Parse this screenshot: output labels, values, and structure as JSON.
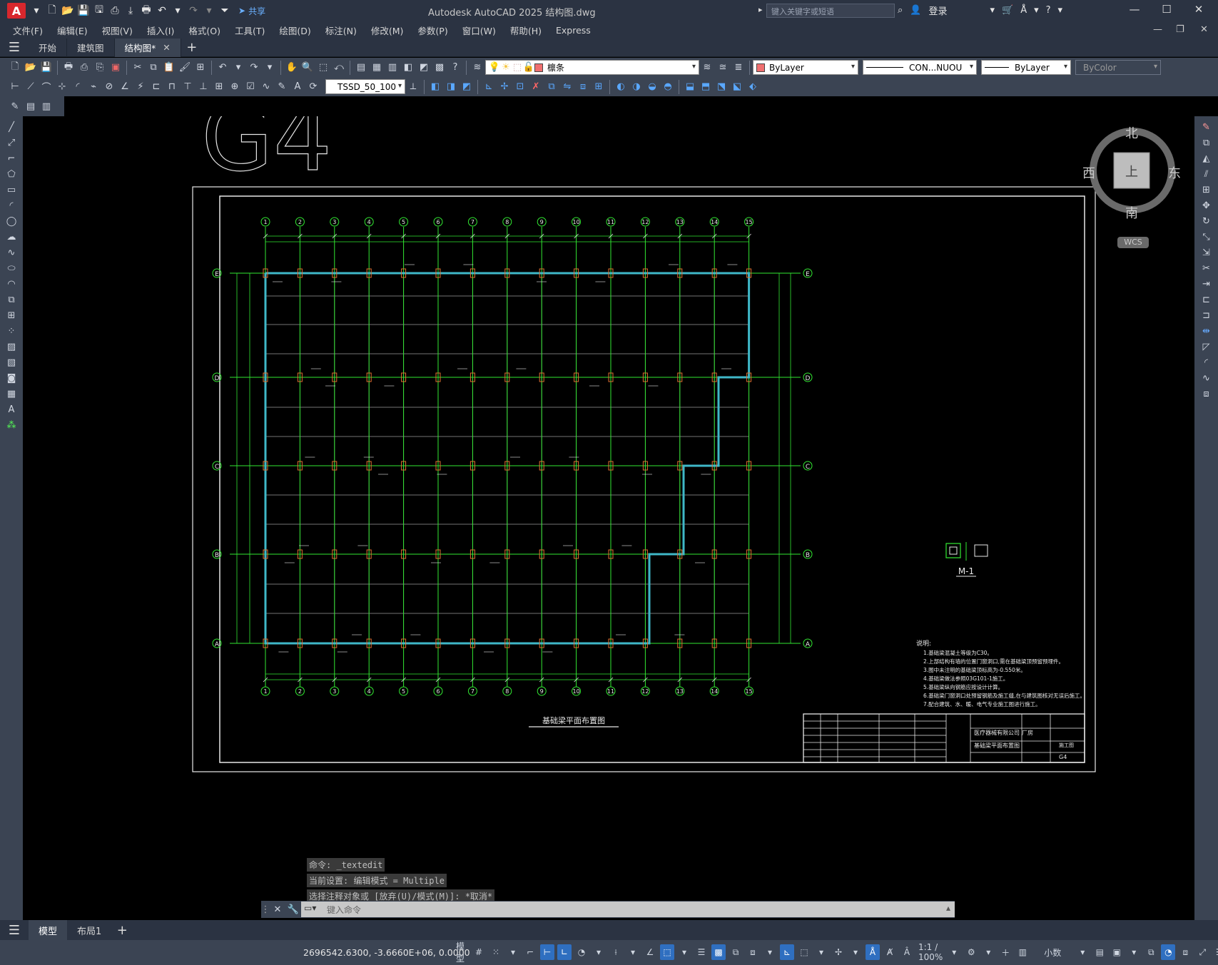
{
  "titlebar": {
    "app_logo": "A",
    "share_label": "共享",
    "title": "Autodesk AutoCAD 2025    结构图.dwg",
    "search_placeholder": "键入关键字或短语",
    "signin_label": "登录"
  },
  "menu": [
    "文件(F)",
    "编辑(E)",
    "视图(V)",
    "插入(I)",
    "格式(O)",
    "工具(T)",
    "绘图(D)",
    "标注(N)",
    "修改(M)",
    "参数(P)",
    "窗口(W)",
    "帮助(H)",
    "Express"
  ],
  "tabs": [
    {
      "label": "开始",
      "active": false
    },
    {
      "label": "建筑图",
      "active": false
    },
    {
      "label": "结构图*",
      "active": true
    }
  ],
  "toolbar": {
    "layer_combo": "檩条",
    "color_combo": "ByLayer",
    "linetype_combo": "CON...NUOU",
    "lineweight_combo": "ByLayer",
    "plotstyle_combo": "ByColor",
    "dimstyle_combo": "TSSD_50_100",
    "colors": {
      "layer_swatch": "#f07070",
      "color_swatch": "#f07070"
    }
  },
  "drawing": {
    "big_label": "G4",
    "plan_title": "基础梁平面布置图",
    "detail_label": "M-1",
    "notes_title": "说明:",
    "notes": [
      "1.基础梁混凝土等级为C30。",
      "2.上部结构有墙的位置门窗洞口,需在基础梁顶预留预埋件。",
      "3.图中未注明的基础梁顶标高为-0.550米。",
      "4.基础梁做法参照03G101-1施工。",
      "5.基础梁纵向钢筋应按设计计算。",
      "6.基础梁门窗洞口处预留钢筋及施工缝,在与建筑图核对无误后施工。",
      "7.配合建筑、水、暖、电气专业施工图进行施工。"
    ],
    "titleblock": {
      "company": "医疗器械有限公司",
      "project": "厂房",
      "drawing_name": "基础梁平面布置图",
      "drawing_no": "G4",
      "stage": "施工图"
    },
    "grid_cols": [
      "1",
      "2",
      "3",
      "4",
      "5",
      "6",
      "7",
      "8",
      "9",
      "10",
      "11",
      "12",
      "13",
      "14",
      "15"
    ],
    "grid_rows": [
      "E",
      "D",
      "C",
      "B",
      "A"
    ]
  },
  "viewcube": {
    "north": "北",
    "south": "南",
    "east": "东",
    "west": "西",
    "face": "上",
    "wcs": "WCS"
  },
  "command": {
    "history": [
      "命令: _textedit",
      "当前设置: 编辑模式 = Multiple",
      "选择注释对象或 [放弃(U)/模式(M)]: *取消*"
    ],
    "input_placeholder": "键入命令"
  },
  "layout_tabs": [
    {
      "label": "模型",
      "active": true
    },
    {
      "label": "布局1",
      "active": false
    }
  ],
  "status": {
    "coords": "2696542.6300, -3.6660E+06, 0.0000",
    "model_label": "模型",
    "scale": "1:1 / 100%",
    "units": "小数"
  }
}
